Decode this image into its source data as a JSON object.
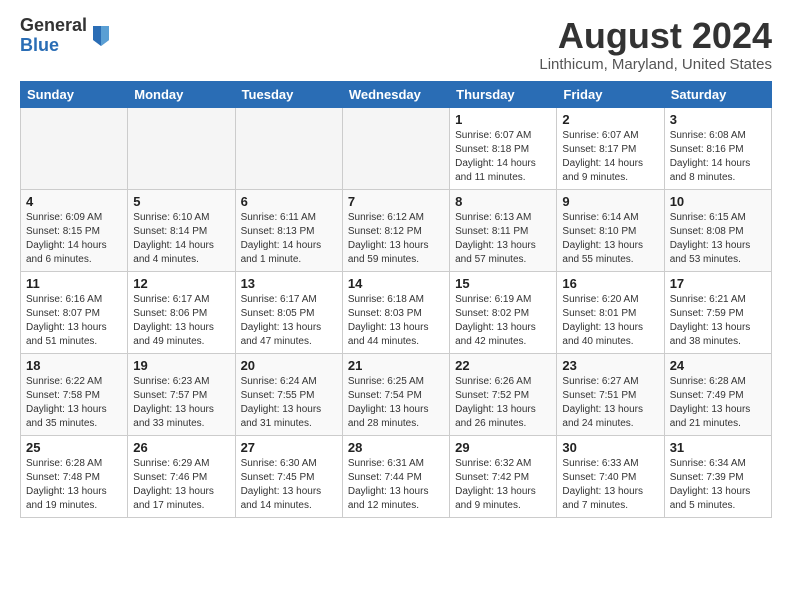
{
  "logo": {
    "general": "General",
    "blue": "Blue"
  },
  "title": "August 2024",
  "location": "Linthicum, Maryland, United States",
  "headers": [
    "Sunday",
    "Monday",
    "Tuesday",
    "Wednesday",
    "Thursday",
    "Friday",
    "Saturday"
  ],
  "weeks": [
    [
      {
        "day": "",
        "empty": true
      },
      {
        "day": "",
        "empty": true
      },
      {
        "day": "",
        "empty": true
      },
      {
        "day": "",
        "empty": true
      },
      {
        "day": "1",
        "sunrise": "6:07 AM",
        "sunset": "8:18 PM",
        "daylight": "14 hours and 11 minutes."
      },
      {
        "day": "2",
        "sunrise": "6:07 AM",
        "sunset": "8:17 PM",
        "daylight": "14 hours and 9 minutes."
      },
      {
        "day": "3",
        "sunrise": "6:08 AM",
        "sunset": "8:16 PM",
        "daylight": "14 hours and 8 minutes."
      }
    ],
    [
      {
        "day": "4",
        "sunrise": "6:09 AM",
        "sunset": "8:15 PM",
        "daylight": "14 hours and 6 minutes."
      },
      {
        "day": "5",
        "sunrise": "6:10 AM",
        "sunset": "8:14 PM",
        "daylight": "14 hours and 4 minutes."
      },
      {
        "day": "6",
        "sunrise": "6:11 AM",
        "sunset": "8:13 PM",
        "daylight": "14 hours and 1 minute."
      },
      {
        "day": "7",
        "sunrise": "6:12 AM",
        "sunset": "8:12 PM",
        "daylight": "13 hours and 59 minutes."
      },
      {
        "day": "8",
        "sunrise": "6:13 AM",
        "sunset": "8:11 PM",
        "daylight": "13 hours and 57 minutes."
      },
      {
        "day": "9",
        "sunrise": "6:14 AM",
        "sunset": "8:10 PM",
        "daylight": "13 hours and 55 minutes."
      },
      {
        "day": "10",
        "sunrise": "6:15 AM",
        "sunset": "8:08 PM",
        "daylight": "13 hours and 53 minutes."
      }
    ],
    [
      {
        "day": "11",
        "sunrise": "6:16 AM",
        "sunset": "8:07 PM",
        "daylight": "13 hours and 51 minutes."
      },
      {
        "day": "12",
        "sunrise": "6:17 AM",
        "sunset": "8:06 PM",
        "daylight": "13 hours and 49 minutes."
      },
      {
        "day": "13",
        "sunrise": "6:17 AM",
        "sunset": "8:05 PM",
        "daylight": "13 hours and 47 minutes."
      },
      {
        "day": "14",
        "sunrise": "6:18 AM",
        "sunset": "8:03 PM",
        "daylight": "13 hours and 44 minutes."
      },
      {
        "day": "15",
        "sunrise": "6:19 AM",
        "sunset": "8:02 PM",
        "daylight": "13 hours and 42 minutes."
      },
      {
        "day": "16",
        "sunrise": "6:20 AM",
        "sunset": "8:01 PM",
        "daylight": "13 hours and 40 minutes."
      },
      {
        "day": "17",
        "sunrise": "6:21 AM",
        "sunset": "7:59 PM",
        "daylight": "13 hours and 38 minutes."
      }
    ],
    [
      {
        "day": "18",
        "sunrise": "6:22 AM",
        "sunset": "7:58 PM",
        "daylight": "13 hours and 35 minutes."
      },
      {
        "day": "19",
        "sunrise": "6:23 AM",
        "sunset": "7:57 PM",
        "daylight": "13 hours and 33 minutes."
      },
      {
        "day": "20",
        "sunrise": "6:24 AM",
        "sunset": "7:55 PM",
        "daylight": "13 hours and 31 minutes."
      },
      {
        "day": "21",
        "sunrise": "6:25 AM",
        "sunset": "7:54 PM",
        "daylight": "13 hours and 28 minutes."
      },
      {
        "day": "22",
        "sunrise": "6:26 AM",
        "sunset": "7:52 PM",
        "daylight": "13 hours and 26 minutes."
      },
      {
        "day": "23",
        "sunrise": "6:27 AM",
        "sunset": "7:51 PM",
        "daylight": "13 hours and 24 minutes."
      },
      {
        "day": "24",
        "sunrise": "6:28 AM",
        "sunset": "7:49 PM",
        "daylight": "13 hours and 21 minutes."
      }
    ],
    [
      {
        "day": "25",
        "sunrise": "6:28 AM",
        "sunset": "7:48 PM",
        "daylight": "13 hours and 19 minutes."
      },
      {
        "day": "26",
        "sunrise": "6:29 AM",
        "sunset": "7:46 PM",
        "daylight": "13 hours and 17 minutes."
      },
      {
        "day": "27",
        "sunrise": "6:30 AM",
        "sunset": "7:45 PM",
        "daylight": "13 hours and 14 minutes."
      },
      {
        "day": "28",
        "sunrise": "6:31 AM",
        "sunset": "7:44 PM",
        "daylight": "13 hours and 12 minutes."
      },
      {
        "day": "29",
        "sunrise": "6:32 AM",
        "sunset": "7:42 PM",
        "daylight": "13 hours and 9 minutes."
      },
      {
        "day": "30",
        "sunrise": "6:33 AM",
        "sunset": "7:40 PM",
        "daylight": "13 hours and 7 minutes."
      },
      {
        "day": "31",
        "sunrise": "6:34 AM",
        "sunset": "7:39 PM",
        "daylight": "13 hours and 5 minutes."
      }
    ]
  ]
}
